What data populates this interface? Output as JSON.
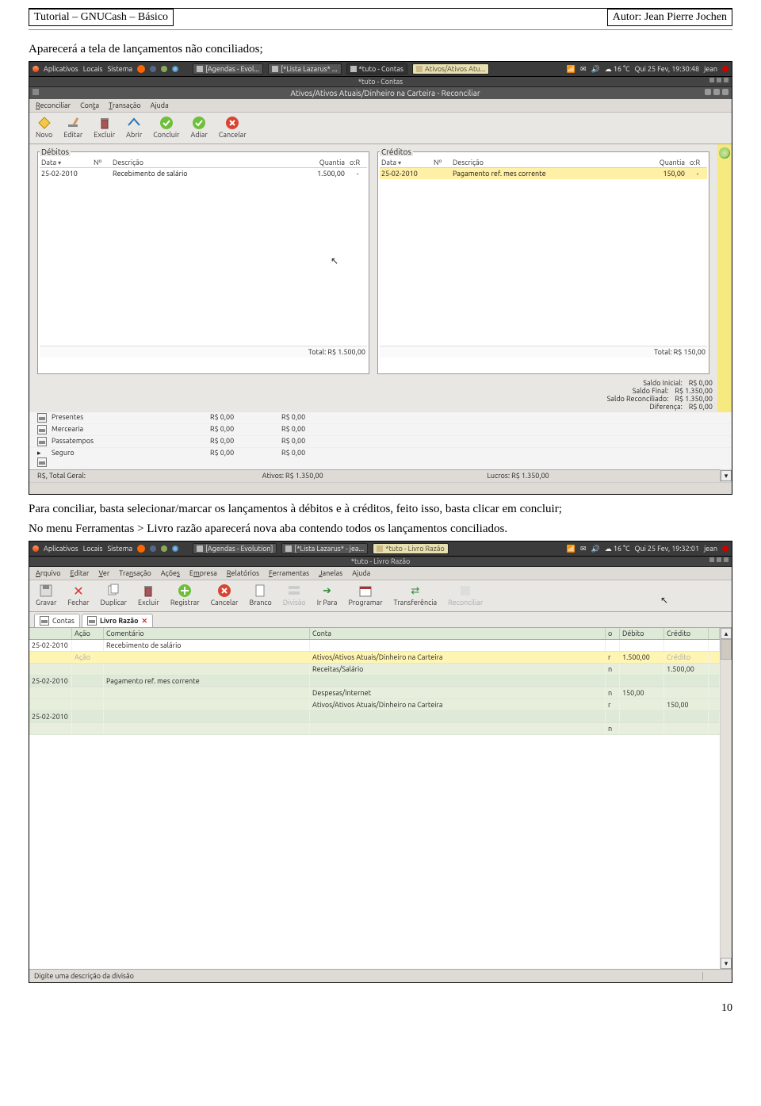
{
  "header": {
    "left": "Tutorial – GNUCash – Básico",
    "right": "Autor: Jean Pierre Jochen"
  },
  "para1": "Aparecerá a tela de lançamentos não conciliados;",
  "para2": "Para conciliar, basta selecionar/marcar os lançamentos à débitos e à créditos, feito isso, basta clicar em concluir;",
  "para3": "No menu Ferramentas > Livro razão aparecerá nova aba contendo todos os lançamentos conciliados.",
  "page_number": "10",
  "s1": {
    "panel": {
      "menus": [
        "Aplicativos",
        "Locais",
        "Sistema"
      ],
      "tasks": [
        {
          "label": "[Agendas - Evol...",
          "active": false
        },
        {
          "label": "[*Lista Lazarus* ...",
          "active": false
        },
        {
          "label": "*tuto - Contas",
          "active": true
        },
        {
          "label": "Ativos/Ativos Atu...",
          "active": false
        }
      ],
      "weather": "16 °C",
      "datetime": "Qui 25 Fev, 19:30:48",
      "user": "jean"
    },
    "outer_title": "*tuto - Contas",
    "dialog_title": "Ativos/Ativos Atuais/Dinheiro na Carteira - Reconciliar",
    "menus": [
      "Reconciliar",
      "Conta",
      "Transação",
      "Ajuda"
    ],
    "toolbar": [
      {
        "label": "Novo",
        "icon": "new"
      },
      {
        "label": "Editar",
        "icon": "edit"
      },
      {
        "label": "Excluir",
        "icon": "delete"
      },
      {
        "label": "Abrir",
        "icon": "open"
      },
      {
        "label": "Concluir",
        "icon": "ok"
      },
      {
        "label": "Adiar",
        "icon": "ok2"
      },
      {
        "label": "Cancelar",
        "icon": "cancel"
      }
    ],
    "debitos": {
      "legend": "Débitos",
      "cols": [
        "Data",
        "Nº",
        "Descrição",
        "Quantia",
        "o:R"
      ],
      "row": {
        "data": "25-02-2010",
        "desc": "Recebimento de salário",
        "qt": "1.500,00",
        "or": "-"
      },
      "total": "Total: R$ 1.500,00"
    },
    "creditos": {
      "legend": "Créditos",
      "cols": [
        "Data",
        "Nº",
        "Descrição",
        "Quantia",
        "o:R"
      ],
      "row": {
        "data": "25-02-2010",
        "desc": "Pagamento ref. mes corrente",
        "qt": "150,00",
        "or": "-"
      },
      "total": "Total: R$ 150,00"
    },
    "summary": [
      {
        "l": "Saldo Inicial:",
        "v": "R$ 0,00"
      },
      {
        "l": "Saldo Final:",
        "v": "R$ 1.350,00"
      },
      {
        "l": "Saldo Reconciliado:",
        "v": "R$ 1.350,00"
      },
      {
        "l": "Diferença:",
        "v": "R$ 0,00"
      }
    ],
    "acct_rows": [
      {
        "name": "Presentes",
        "c1": "R$ 0,00",
        "c2": "R$ 0,00"
      },
      {
        "name": "Mercearia",
        "c1": "R$ 0,00",
        "c2": "R$ 0,00"
      },
      {
        "name": "Passatempos",
        "c1": "R$ 0,00",
        "c2": "R$ 0,00"
      },
      {
        "name": "Seguro",
        "c1": "R$ 0,00",
        "c2": "R$ 0,00"
      }
    ],
    "status": {
      "left": "R$, Total Geral:",
      "center": "Ativos: R$ 1.350,00",
      "right": "Lucros: R$ 1.350,00"
    }
  },
  "s2": {
    "panel": {
      "menus": [
        "Aplicativos",
        "Locais",
        "Sistema"
      ],
      "tasks": [
        {
          "label": "[Agendas - Evolution]",
          "active": false
        },
        {
          "label": "[*Lista Lazarus* - jea...",
          "active": false
        },
        {
          "label": "*tuto - Livro Razão",
          "active": true
        }
      ],
      "weather": "16 °C",
      "datetime": "Qui 25 Fev, 19:32:01",
      "user": "jean"
    },
    "outer_title": "*tuto - Livro Razão",
    "menus": [
      "Arquivo",
      "Editar",
      "Ver",
      "Transação",
      "Ações",
      "Empresa",
      "Relatórios",
      "Ferramentas",
      "Janelas",
      "Ajuda"
    ],
    "toolbar": [
      {
        "label": "Gravar",
        "icon": "save"
      },
      {
        "label": "Fechar",
        "icon": "close"
      },
      {
        "label": "Duplicar",
        "icon": "dup"
      },
      {
        "label": "Excluir",
        "icon": "del"
      },
      {
        "label": "Registrar",
        "icon": "reg"
      },
      {
        "label": "Cancelar",
        "icon": "cancel"
      },
      {
        "label": "Branco",
        "icon": "blank"
      },
      {
        "label": "Divisão",
        "icon": "split",
        "disabled": true
      },
      {
        "label": "Ir Para",
        "icon": "goto"
      },
      {
        "label": "Programar",
        "icon": "sched"
      },
      {
        "label": "Transferência",
        "icon": "xfer"
      },
      {
        "label": "Reconciliar",
        "icon": "recon",
        "disabled": true
      }
    ],
    "tabs": [
      {
        "label": "Contas"
      },
      {
        "label": "Livro Razão",
        "active": true,
        "closable": true
      }
    ],
    "reg_cols": [
      "",
      "Ação",
      "Comentário",
      "Conta",
      "o",
      "Débito",
      "Crédito"
    ],
    "rows": [
      {
        "cls": "",
        "c0": "25-02-2010",
        "c1": "",
        "c2": "Recebimento de salário",
        "c3": "",
        "c4": "",
        "c5": "",
        "c6": ""
      },
      {
        "cls": "yellow",
        "c0": "",
        "c1": "Ação",
        "c2": "",
        "c3": "Ativos/Ativos Atuais/Dinheiro na Carteira",
        "c4": "r",
        "c5": "1.500,00",
        "c6": "Crédito",
        "c6grey": true,
        "c1grey": true
      },
      {
        "cls": "green",
        "c0": "",
        "c1": "",
        "c2": "",
        "c3": "Receitas/Salário",
        "c4": "n",
        "c5": "",
        "c6": "1.500,00"
      },
      {
        "cls": "dgreen",
        "c0": "25-02-2010",
        "c1": "",
        "c2": "Pagamento ref. mes corrente",
        "c3": "",
        "c4": "",
        "c5": "",
        "c6": ""
      },
      {
        "cls": "green",
        "c0": "",
        "c1": "",
        "c2": "",
        "c3": "Despesas/Internet",
        "c4": "n",
        "c5": "150,00",
        "c6": ""
      },
      {
        "cls": "green",
        "c0": "",
        "c1": "",
        "c2": "",
        "c3": "Ativos/Ativos Atuais/Dinheiro na Carteira",
        "c4": "r",
        "c5": "",
        "c6": "150,00"
      },
      {
        "cls": "dgreen",
        "c0": "25-02-2010",
        "c1": "",
        "c2": "",
        "c3": "",
        "c4": "",
        "c5": "",
        "c6": ""
      },
      {
        "cls": "green",
        "c0": "",
        "c1": "",
        "c2": "",
        "c3": "",
        "c4": "n",
        "c5": "",
        "c6": ""
      }
    ],
    "statusline": "Digite uma descrição da divisão"
  }
}
